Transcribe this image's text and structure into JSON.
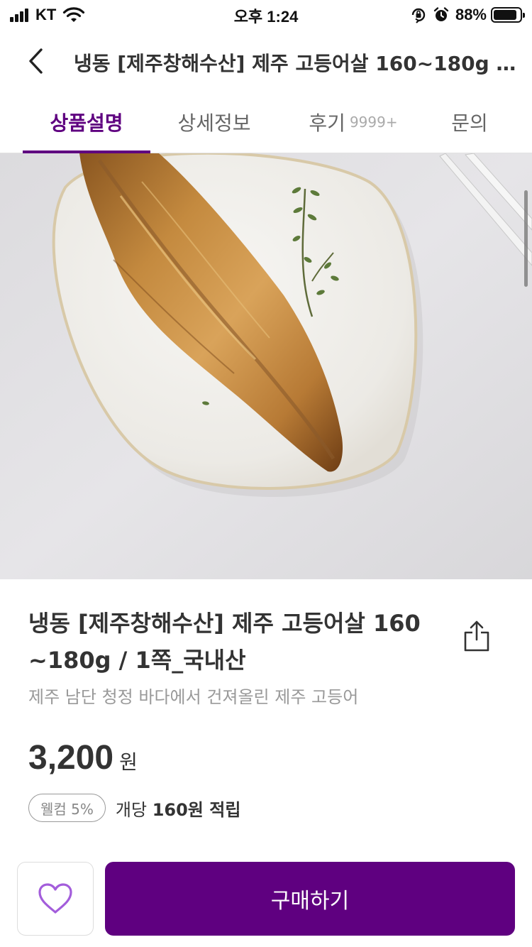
{
  "status_bar": {
    "carrier": "KT",
    "time": "오후 1:24",
    "battery_percent": "88%",
    "battery_level": 0.88,
    "icons": [
      "signal-icon",
      "wifi-icon",
      "orientation-lock-icon",
      "alarm-icon",
      "battery-icon"
    ]
  },
  "header": {
    "title": "냉동 [제주창해수산] 제주 고등어살 160~180g / 1쪽_국내산",
    "back_icon": "chevron-left-icon"
  },
  "tabs": [
    {
      "label": "상품설명",
      "active": true
    },
    {
      "label": "상세정보",
      "active": false
    },
    {
      "label": "후기",
      "count": "9999+",
      "active": false
    },
    {
      "label": "문의",
      "active": false
    }
  ],
  "product": {
    "image_alt": "product-photo",
    "name_line1": "냉동 [제주창해수산] 제주 고등어살 160",
    "name_line2": "~180g / 1쪽_국내산",
    "description": "제주 남단 청정 바다에서 건져올린 제주 고등어",
    "price": "3,200",
    "price_unit": "원",
    "welcome_badge": "웰컴 5%",
    "point_prefix": "개당",
    "point_amount": "160원 적립",
    "share_icon": "share-icon"
  },
  "bottom_bar": {
    "wish_icon": "heart-icon",
    "buy_label": "구매하기"
  },
  "colors": {
    "accent": "#5f0080",
    "wish_heart": "#a35ddb",
    "text_dark": "#333333",
    "text_muted": "#999999"
  }
}
